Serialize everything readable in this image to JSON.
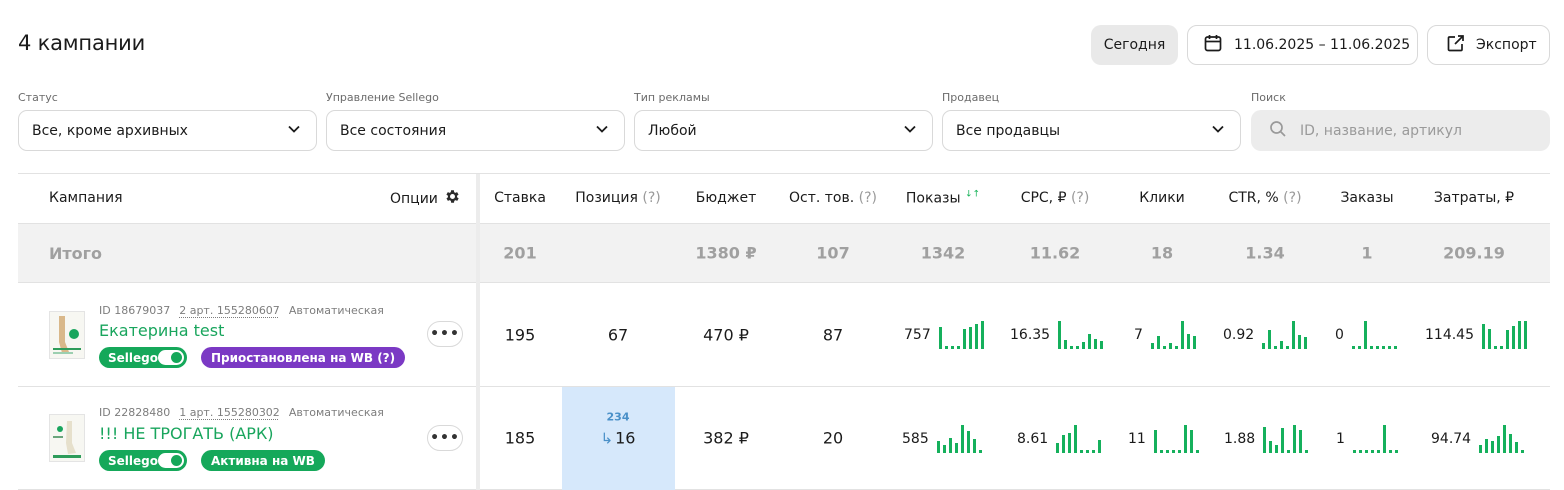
{
  "header": {
    "title": "4 кампании",
    "today_label": "Сегодня",
    "date_range": "11.06.2025 – 11.06.2025",
    "export_label": "Экспорт"
  },
  "filters": {
    "status": {
      "label": "Статус",
      "value": "Все, кроме архивных"
    },
    "sellego": {
      "label": "Управление Sellego",
      "value": "Все состояния"
    },
    "ad_type": {
      "label": "Тип рекламы",
      "value": "Любой"
    },
    "seller": {
      "label": "Продавец",
      "value": "Все продавцы"
    },
    "search": {
      "label": "Поиск",
      "placeholder": "ID, название, артикул"
    }
  },
  "table": {
    "columns": {
      "campaign": "Кампания",
      "options": "Опции",
      "bid": "Ставка",
      "position": "Позиция",
      "budget": "Бюджет",
      "stock": "Ост. тов.",
      "impressions": "Показы",
      "cpc": "CPC, ₽",
      "clicks": "Клики",
      "ctr": "CTR, %",
      "orders": "Заказы",
      "spend": "Затраты, ₽",
      "help": "(?)",
      "sort_icon": "↓↑"
    },
    "totals": {
      "label": "Итого",
      "bid": "201",
      "budget": "1380 ₽",
      "stock": "107",
      "impressions": "1342",
      "cpc": "11.62",
      "clicks": "18",
      "ctr": "1.34",
      "orders": "1",
      "spend": "209.19"
    },
    "rows": [
      {
        "id": "ID 18679037",
        "articles": "2 арт. 155280607",
        "type": "Автоматическая",
        "name": "Екатерина test",
        "sellego": "Sellego",
        "status": "Приостановлена на WB (?)",
        "status_color": "#7b39c4",
        "bid": "195",
        "position": "67",
        "budget": "470 ₽",
        "stock": "87",
        "impressions": "757",
        "cpc": "16.35",
        "clicks": "7",
        "ctr": "0.92",
        "orders": "0",
        "spend": "114.45"
      },
      {
        "id": "ID 22828480",
        "articles": "1 арт. 155280302",
        "type": "Автоматическая",
        "name": "!!! НЕ ТРОГАТЬ (АРК)",
        "sellego": "Sellego",
        "status": "Активна на WB",
        "status_color": "#15a85a",
        "bid": "185",
        "position_old": "234",
        "position": "16",
        "budget": "382 ₽",
        "stock": "20",
        "impressions": "585",
        "cpc": "8.61",
        "clicks": "11",
        "ctr": "1.88",
        "orders": "1",
        "spend": "94.74"
      }
    ]
  },
  "colors": {
    "accent": "#19a55d",
    "bar": "#15b05c",
    "purple": "#7b39c4",
    "highlight": "#d6e8fb"
  },
  "icons": [
    "calendar-icon",
    "export-icon",
    "chevron-down-icon",
    "search-icon",
    "gear-icon",
    "more-icon",
    "arrow-icon"
  ]
}
